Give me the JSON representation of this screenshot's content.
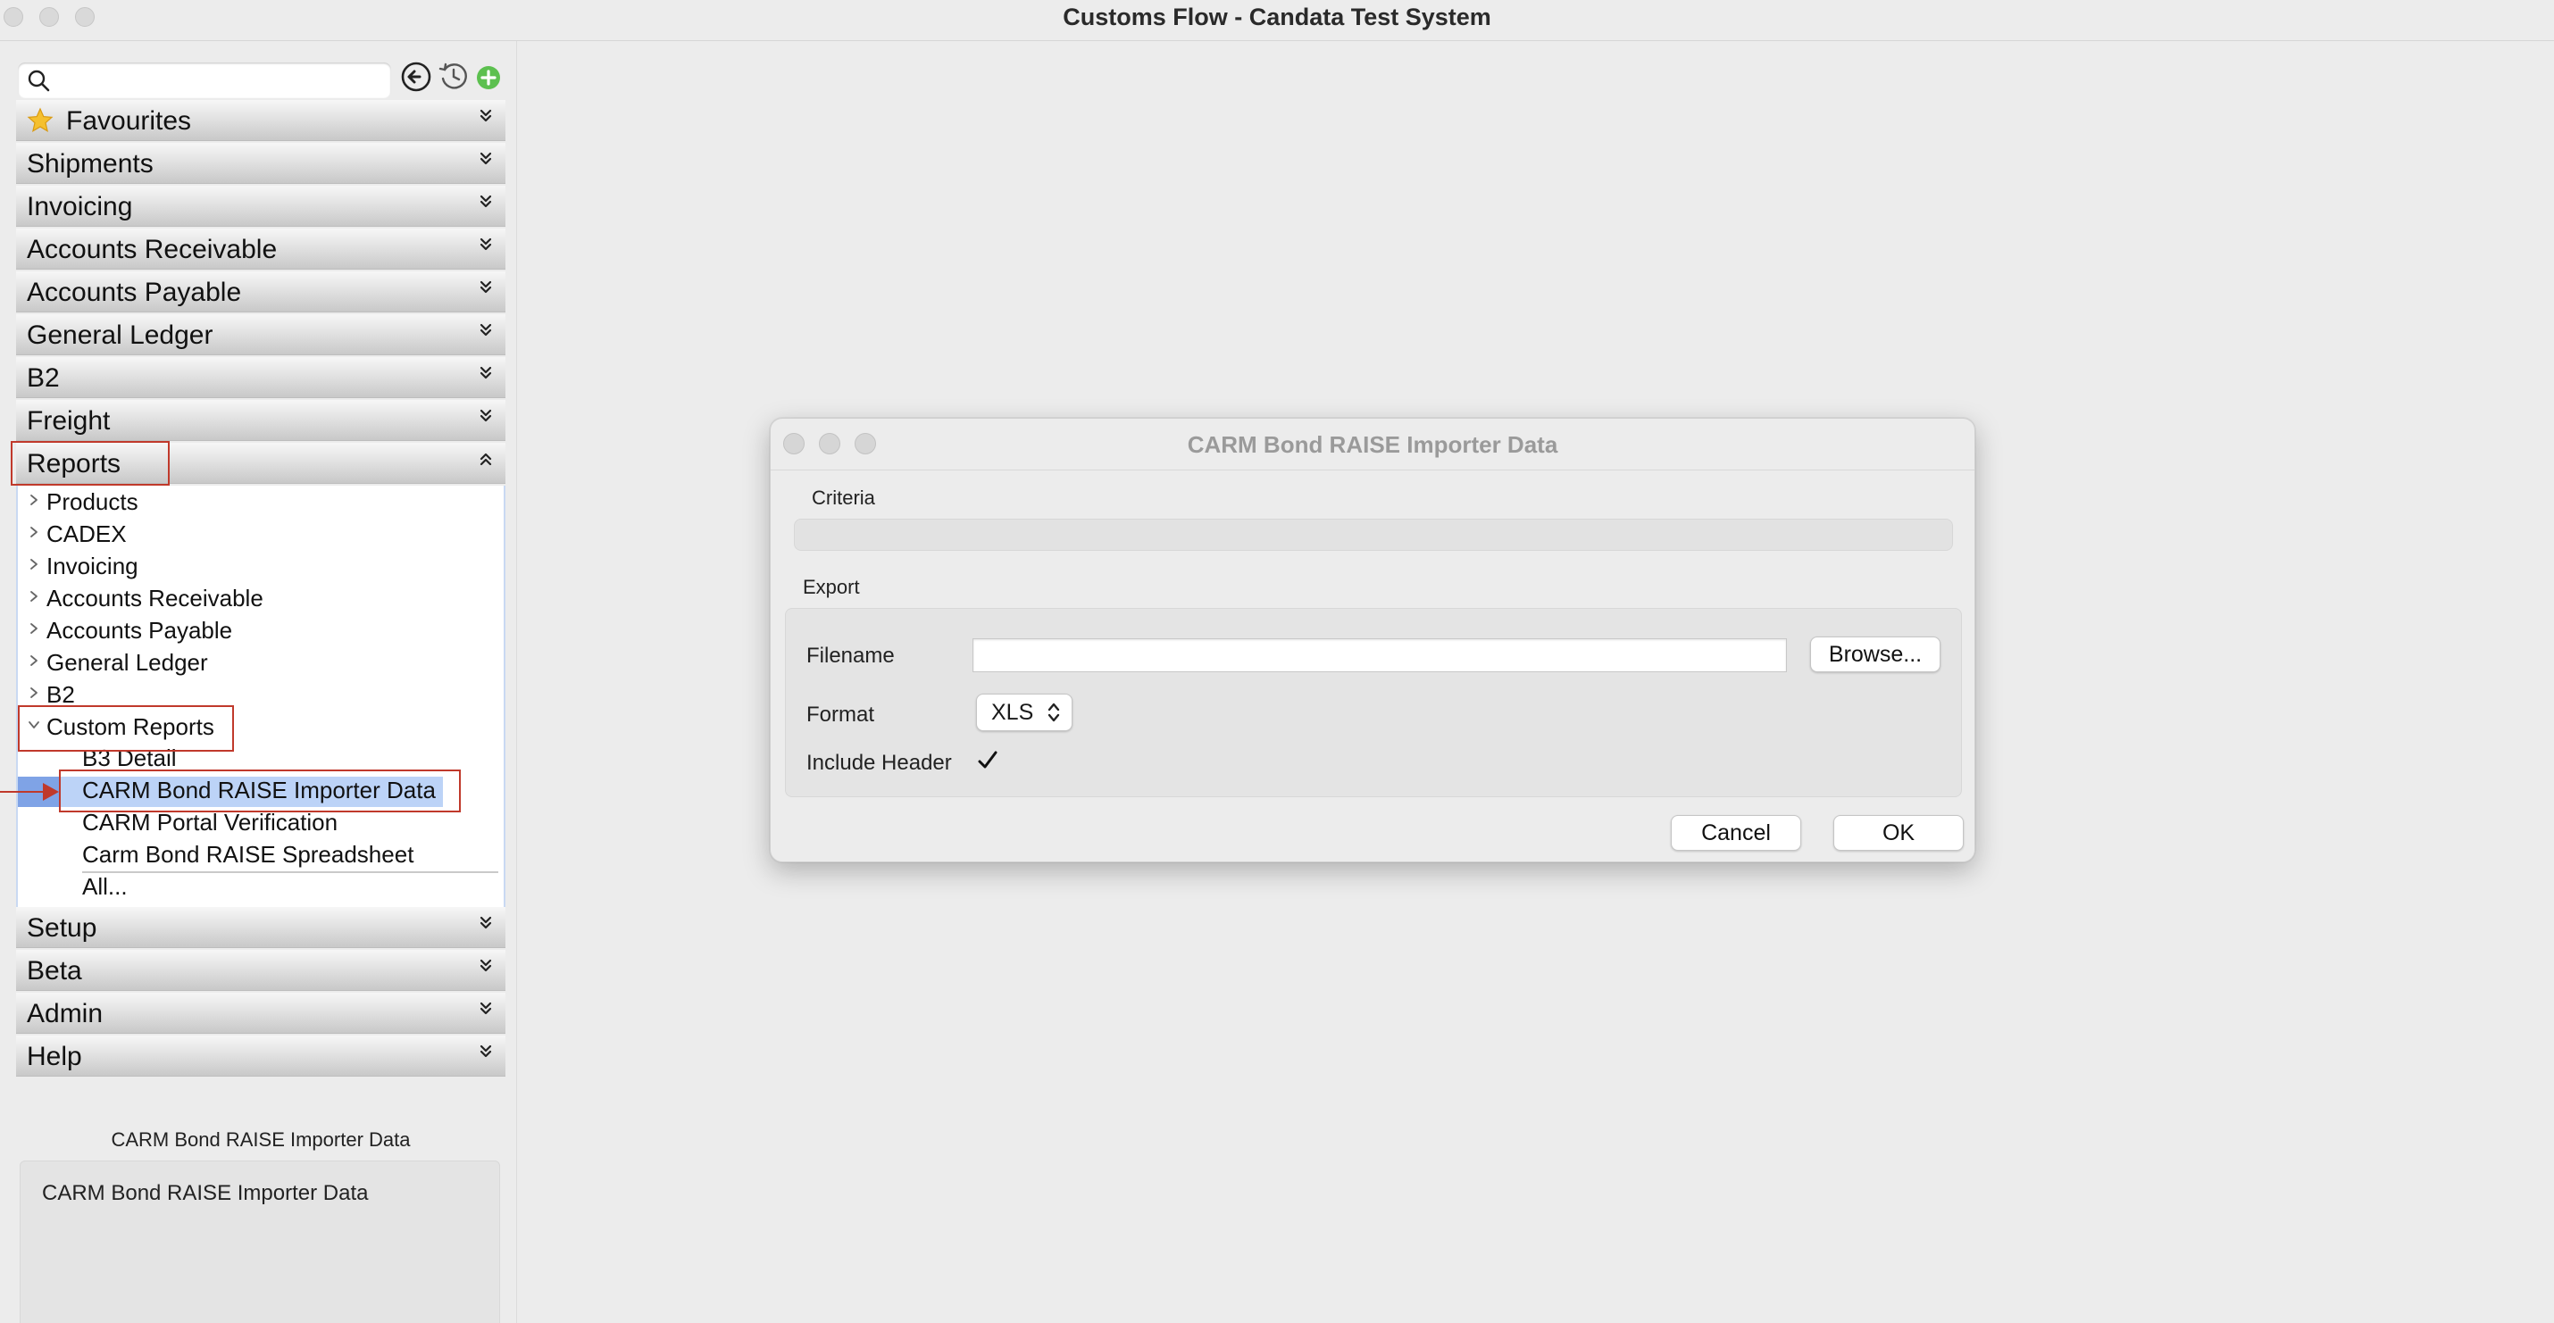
{
  "window": {
    "title": "Customs Flow - Candata Test System"
  },
  "sidebar": {
    "search": {
      "value": "",
      "placeholder": ""
    },
    "toolbar_icons": [
      "back-arrow-icon",
      "history-icon",
      "add-icon"
    ],
    "sections": [
      {
        "label": "Favourites",
        "icon": "star-icon",
        "expanded": false
      },
      {
        "label": "Shipments",
        "expanded": false
      },
      {
        "label": "Invoicing",
        "expanded": false
      },
      {
        "label": "Accounts Receivable",
        "expanded": false
      },
      {
        "label": "Accounts Payable",
        "expanded": false
      },
      {
        "label": "General Ledger",
        "expanded": false
      },
      {
        "label": "B2",
        "expanded": false
      },
      {
        "label": "Freight",
        "expanded": false
      },
      {
        "label": "Reports",
        "expanded": true
      },
      {
        "label": "Setup",
        "expanded": false
      },
      {
        "label": "Beta",
        "expanded": false
      },
      {
        "label": "Admin",
        "expanded": false
      },
      {
        "label": "Help",
        "expanded": false
      }
    ],
    "reports_tree": [
      {
        "label": "Products",
        "expanded": false
      },
      {
        "label": "CADEX",
        "expanded": false
      },
      {
        "label": "Invoicing",
        "expanded": false
      },
      {
        "label": "Accounts Receivable",
        "expanded": false
      },
      {
        "label": "Accounts Payable",
        "expanded": false
      },
      {
        "label": "General Ledger",
        "expanded": false
      },
      {
        "label": "B2",
        "expanded": false
      },
      {
        "label": "Custom Reports",
        "expanded": true
      }
    ],
    "custom_reports": [
      {
        "label": "B3 Detail",
        "selected": false
      },
      {
        "label": "CARM Bond RAISE Importer Data",
        "selected": true
      },
      {
        "label": "CARM Portal Verification",
        "selected": false
      },
      {
        "label": "Carm Bond RAISE Spreadsheet",
        "selected": false
      },
      {
        "label": "All...",
        "selected": false
      }
    ],
    "description": {
      "title": "CARM Bond RAISE Importer Data",
      "text": "CARM Bond RAISE Importer Data"
    }
  },
  "dialog": {
    "title": "CARM Bond RAISE Importer Data",
    "criteria_label": "Criteria",
    "export_label": "Export",
    "filename_label": "Filename",
    "filename_value": "",
    "browse_label": "Browse...",
    "format_label": "Format",
    "format_value": "XLS",
    "include_header_label": "Include Header",
    "include_header_checked": true,
    "cancel_label": "Cancel",
    "ok_label": "OK"
  },
  "colors": {
    "annotation": "#c0392b",
    "selection": "#bcd3f7",
    "add_icon": "#5cc04f"
  }
}
